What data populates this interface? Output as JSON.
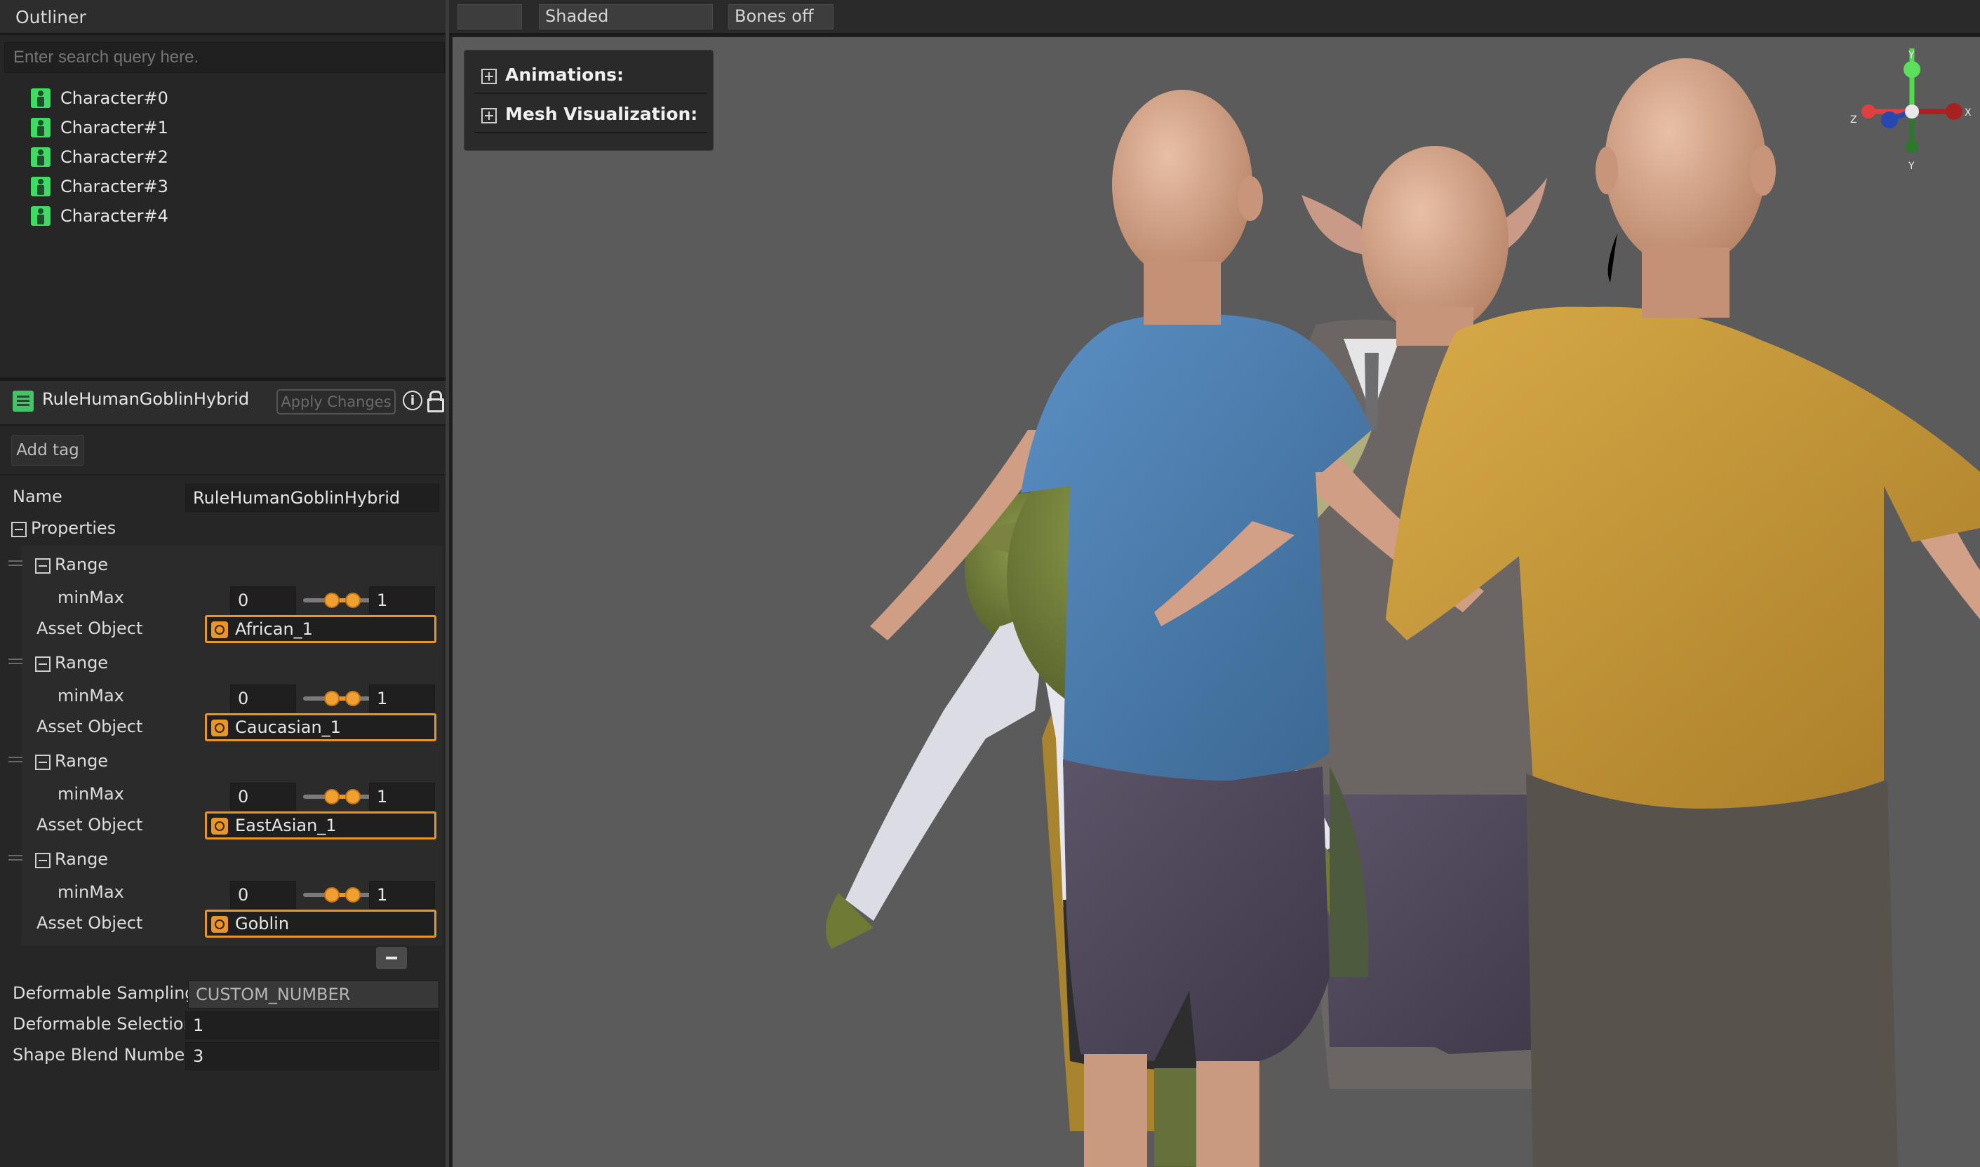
{
  "outliner": {
    "title": "Outliner",
    "search_placeholder": "Enter search query here.",
    "items": [
      {
        "label": "Character#0"
      },
      {
        "label": "Character#1"
      },
      {
        "label": "Character#2"
      },
      {
        "label": "Character#3"
      },
      {
        "label": "Character#4"
      }
    ]
  },
  "inspector": {
    "rule_name": "RuleHumanGoblinHybrid",
    "apply_label": "Apply Changes",
    "info_glyph": "i",
    "add_tag_label": "Add tag",
    "name_label": "Name",
    "name_value": "RuleHumanGoblinHybrid",
    "properties_label": "Properties",
    "ranges": [
      {
        "label": "Range",
        "minmax_label": "minMax",
        "min": "0",
        "max": "1",
        "asset_label": "Asset Object",
        "asset": "African_1"
      },
      {
        "label": "Range",
        "minmax_label": "minMax",
        "min": "0",
        "max": "1",
        "asset_label": "Asset Object",
        "asset": "Caucasian_1"
      },
      {
        "label": "Range",
        "minmax_label": "minMax",
        "min": "0",
        "max": "1",
        "asset_label": "Asset Object",
        "asset": "EastAsian_1"
      },
      {
        "label": "Range",
        "minmax_label": "minMax",
        "min": "0",
        "max": "1",
        "asset_label": "Asset Object",
        "asset": "Goblin"
      }
    ],
    "deformable_sampling_label": "Deformable Sampling",
    "deformable_sampling_value": "CUSTOM_NUMBER",
    "deformable_selection_label": "Deformable Selection",
    "deformable_selection_value": "1",
    "shape_blend_label": "Shape Blend Number",
    "shape_blend_value": "3"
  },
  "viewport": {
    "toolbar": {
      "blank_label": "",
      "shading_label": "Shaded",
      "bones_label": "Bones off"
    },
    "overlay": {
      "animations_label": "Animations:",
      "mesh_label": "Mesh Visualization:"
    },
    "gizmo": {
      "y_label": "Y",
      "y_neg_label": "Y",
      "x_label": "X",
      "z_label": "Z"
    }
  },
  "colors": {
    "accent_orange": "#e8962a",
    "character_icon_green": "#3ddc63",
    "viewport_bg": "#5b5b5b",
    "blue_shirt": "#4a7fb3",
    "mustard_shirt": "#c99a34",
    "goblin_skin": "#7a8a3a"
  }
}
